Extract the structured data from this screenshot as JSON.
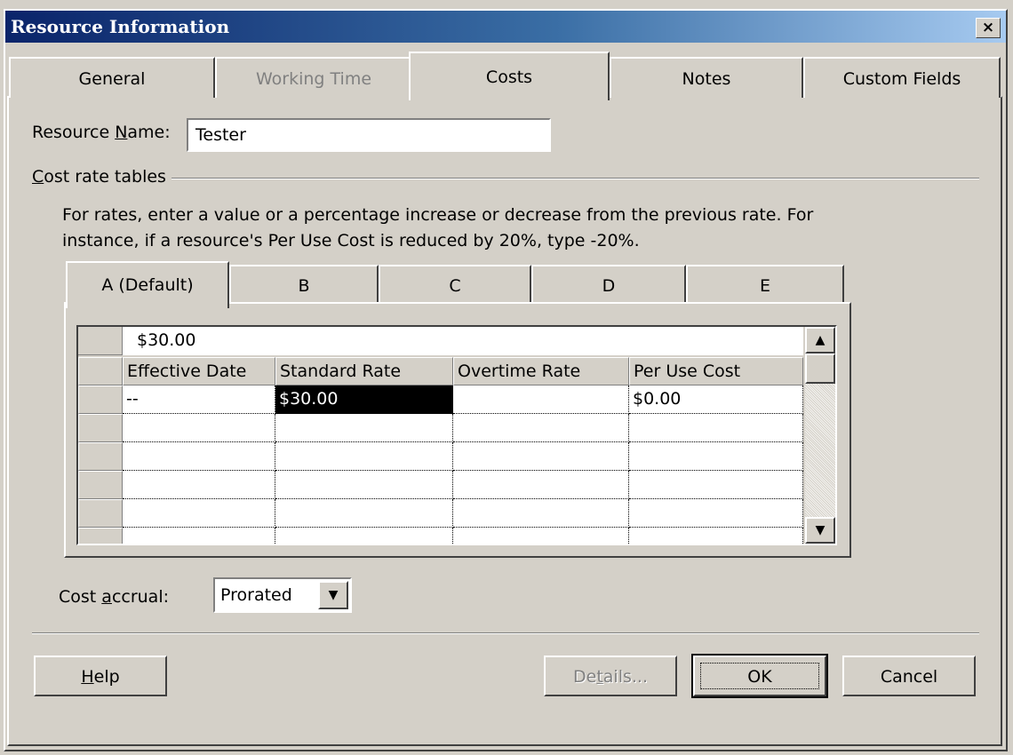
{
  "window": {
    "title": "Resource Information",
    "close_symbol": "×"
  },
  "tabs": [
    {
      "label": "General",
      "state": "normal"
    },
    {
      "label": "Working Time",
      "state": "disabled"
    },
    {
      "label": "Costs",
      "state": "active"
    },
    {
      "label": "Notes",
      "state": "normal"
    },
    {
      "label": "Custom Fields",
      "state": "normal"
    }
  ],
  "resource": {
    "name_label_pre": "Resource ",
    "name_label_key": "N",
    "name_label_post": "ame:",
    "name_value": "Tester"
  },
  "cost_rate": {
    "group_label_key": "C",
    "group_label_post": "ost rate tables",
    "instructions": "For rates, enter a value or a percentage increase or decrease from the previous rate. For instance, if a resource's Per Use Cost is reduced by 20%, type -20%.",
    "tabs": [
      "A (Default)",
      "B",
      "C",
      "D",
      "E"
    ],
    "active_tab": "A (Default)"
  },
  "grid": {
    "edit_value": "$30.00",
    "columns": [
      "Effective Date",
      "Standard Rate",
      "Overtime Rate",
      "Per Use Cost"
    ],
    "rows": [
      [
        "--",
        "$30.00",
        "",
        "$0.00"
      ],
      [
        "",
        "",
        "",
        ""
      ],
      [
        "",
        "",
        "",
        ""
      ],
      [
        "",
        "",
        "",
        ""
      ],
      [
        "",
        "",
        "",
        ""
      ],
      [
        "",
        "",
        "",
        ""
      ]
    ],
    "selected_cell": "Standard Rate, row 1"
  },
  "accrual": {
    "label_pre": "Cost ",
    "label_key": "a",
    "label_post": "ccrual:",
    "value": "Prorated"
  },
  "buttons": {
    "help_key": "H",
    "help_post": "elp",
    "details_pre": "De",
    "details_key": "t",
    "details_post": "ails...",
    "ok": "OK",
    "cancel": "Cancel"
  },
  "colors": {
    "titlebar_start": "#0a246a",
    "titlebar_end": "#a6caf0",
    "face": "#d4d0c8"
  }
}
